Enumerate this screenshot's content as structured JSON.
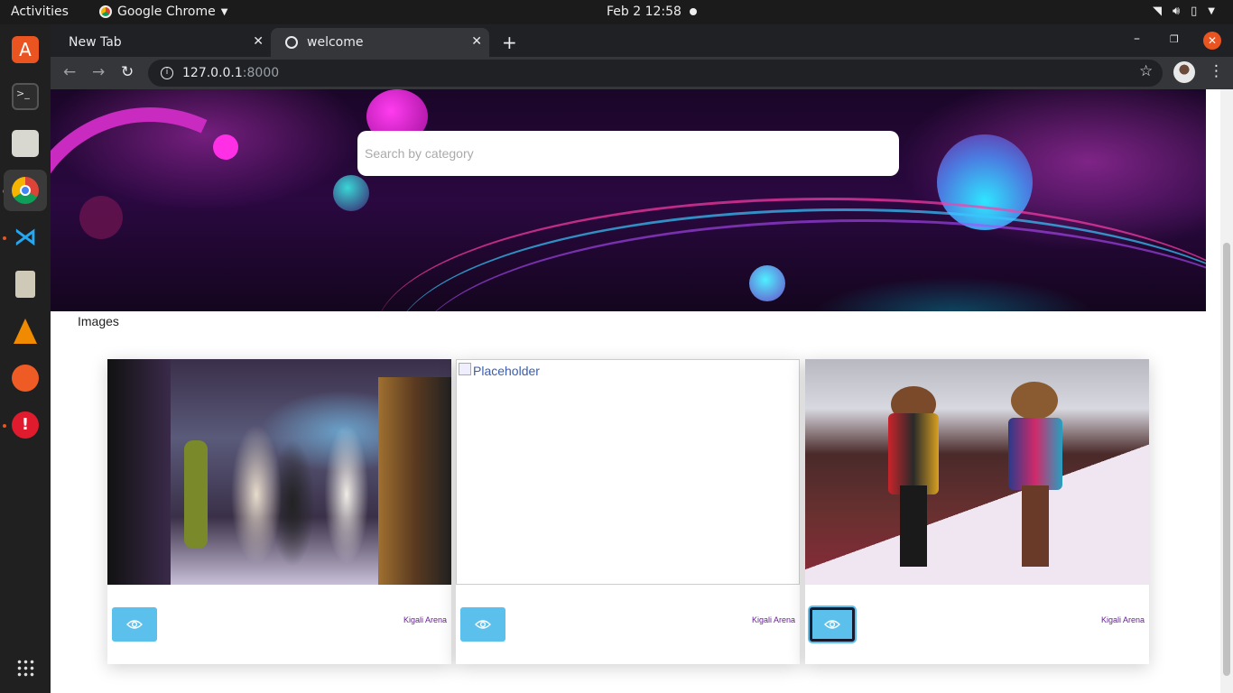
{
  "topbar": {
    "activities": "Activities",
    "app_name": "Google Chrome",
    "clock": "Feb 2  12:58"
  },
  "dock": {
    "items": [
      "ubuntu-software-icon",
      "terminal-icon",
      "files-icon",
      "chrome-icon",
      "vscode-icon",
      "archive-icon",
      "vlc-icon",
      "postman-icon",
      "error-report-icon"
    ],
    "show_apps_icon": "apps-grid-icon"
  },
  "browser": {
    "tabs": [
      {
        "label": "New Tab",
        "active": false
      },
      {
        "label": "welcome",
        "active": true
      }
    ],
    "url_host": "127.0.0.1",
    "url_port": ":8000"
  },
  "page": {
    "search": {
      "placeholder": "Search by category",
      "value": ""
    },
    "section_title": "Images",
    "cards": [
      {
        "image": "fashion-show-photo",
        "location": "Kigali Arena",
        "button_icon": "eye-icon"
      },
      {
        "image": "broken-image",
        "alt": "Placeholder",
        "location": "Kigali Arena",
        "button_icon": "eye-icon"
      },
      {
        "image": "runway-models-photo",
        "location": "Kigali Arena",
        "button_icon": "eye-icon"
      }
    ]
  },
  "colors": {
    "accent_button": "#5bc0eb",
    "location_text": "#6a1b9a",
    "dock_run_indicator": "#e95420"
  }
}
